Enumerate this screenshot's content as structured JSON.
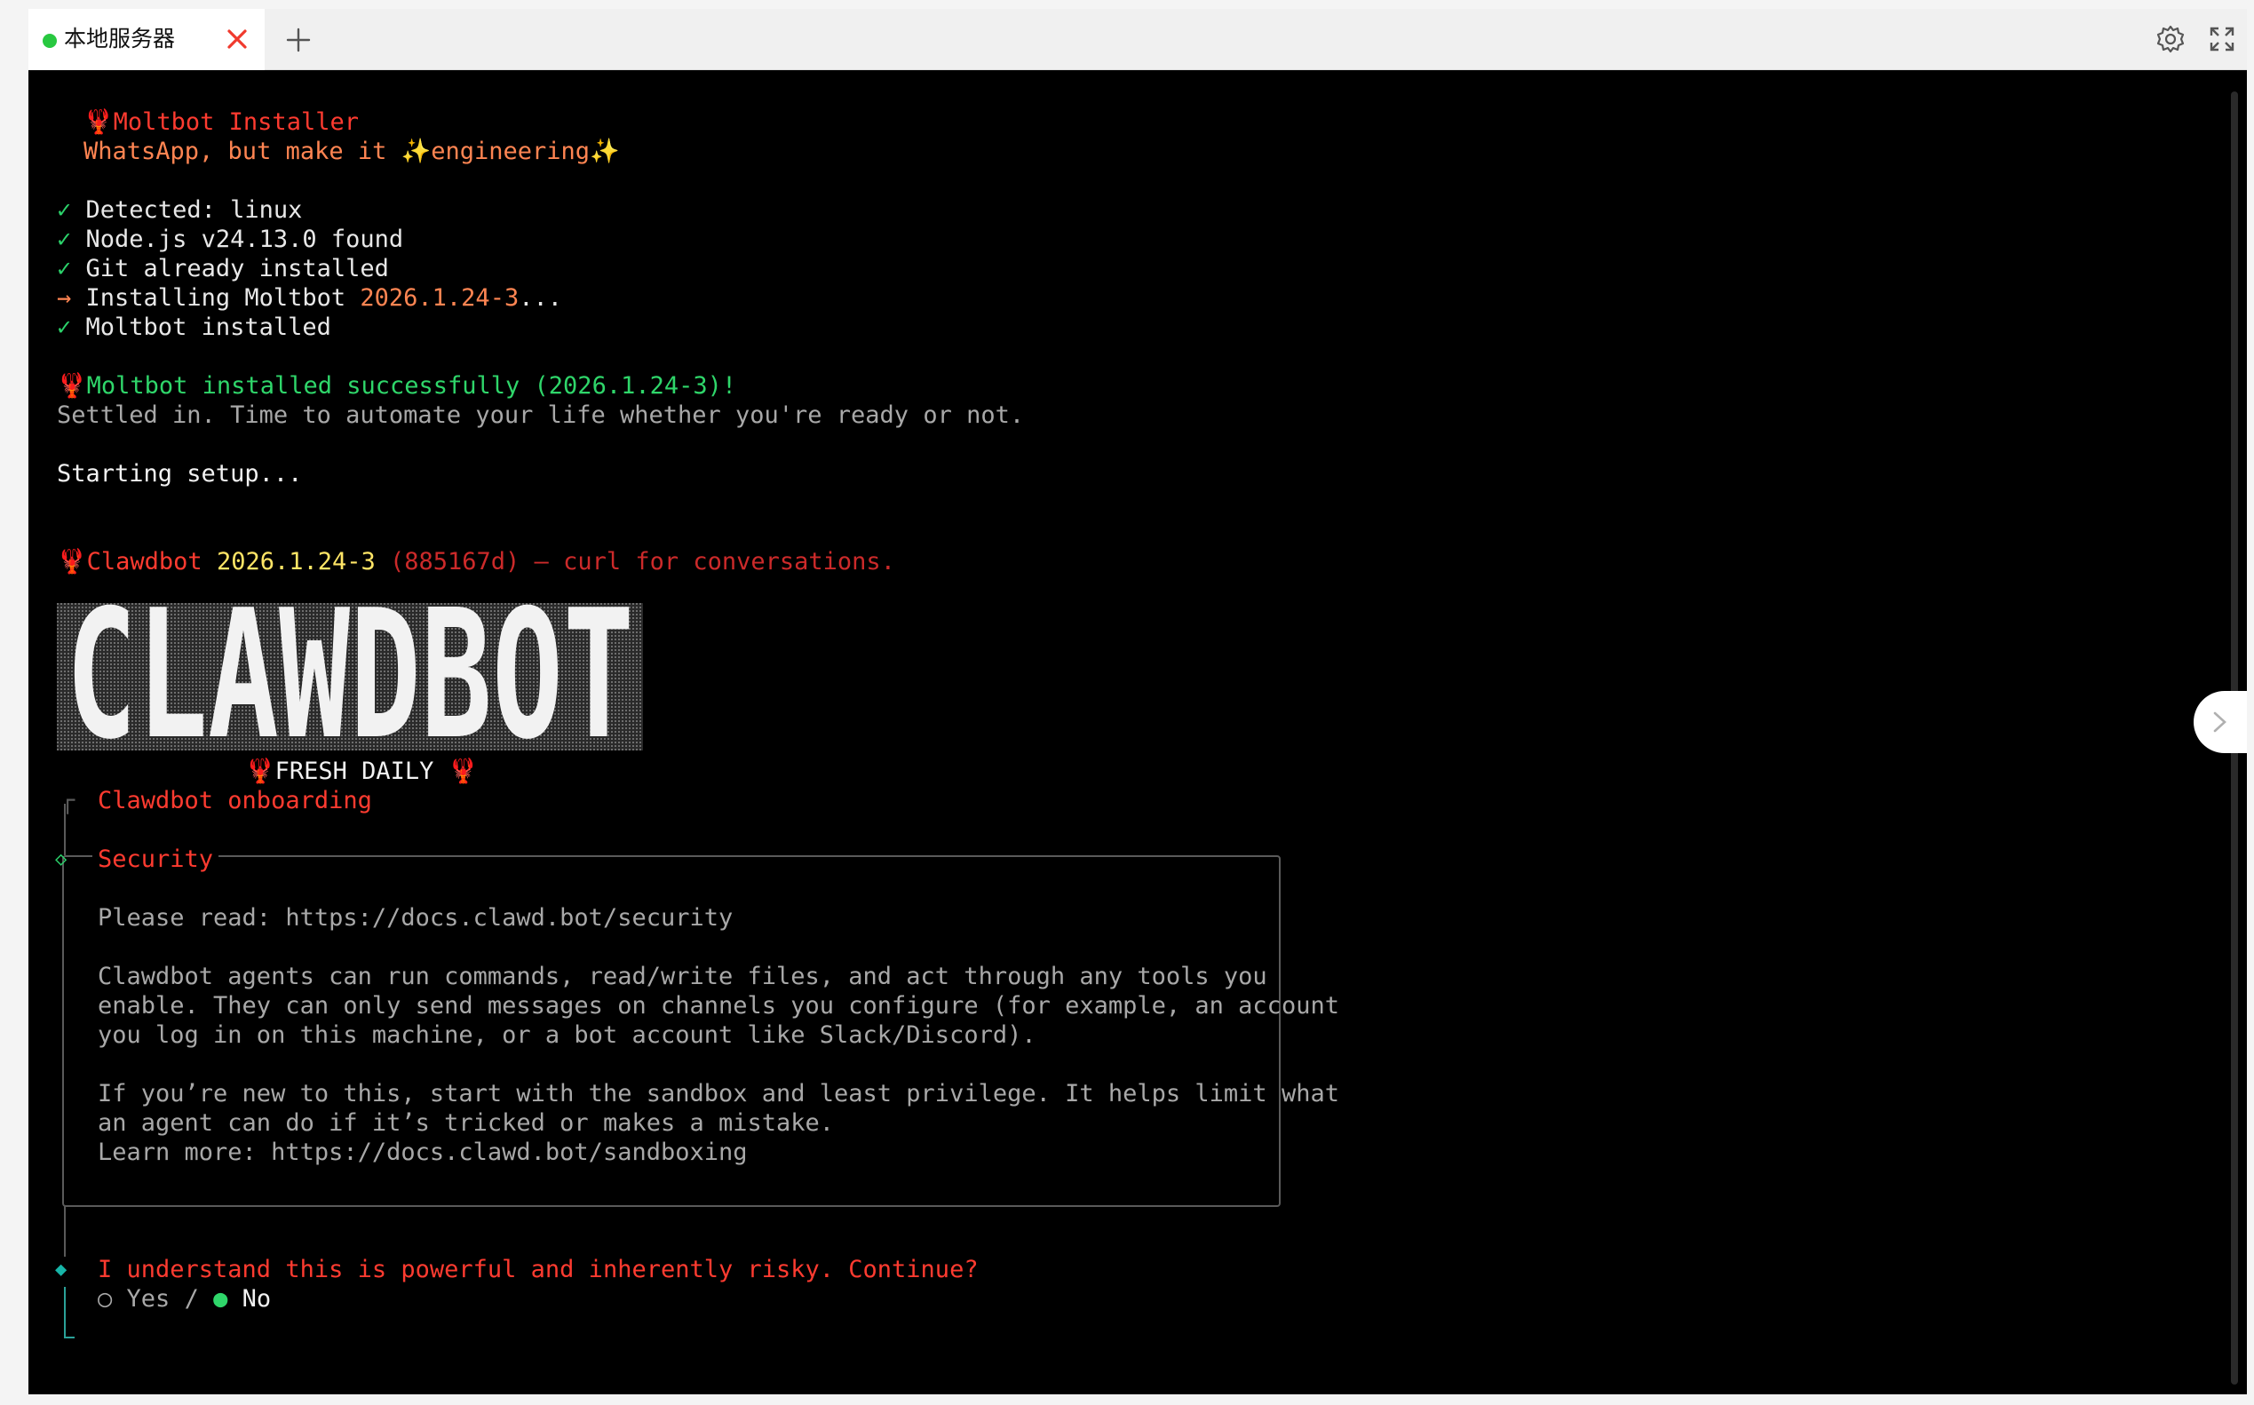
{
  "tabs": [
    {
      "label": "本地服务器",
      "status_color": "#28c840",
      "active": true
    }
  ],
  "toolbar": {
    "settings_icon": "gear-icon",
    "fullscreen_icon": "expand-icon",
    "add_icon": "plus-icon",
    "close_icon": "close-icon"
  },
  "terminal": {
    "installer_title": "Moltbot Installer",
    "installer_tagline_pre": "WhatsApp, but make it ",
    "installer_tagline_word": "engineering",
    "checks": [
      {
        "mark": "✓",
        "text": "Detected: linux"
      },
      {
        "mark": "✓",
        "text": "Node.js v24.13.0 found"
      },
      {
        "mark": "✓",
        "text": "Git already installed"
      }
    ],
    "installing_mark": "→",
    "installing_prefix": "Installing Moltbot ",
    "installing_version": "2026.1.24-3",
    "installing_suffix": "...",
    "installed_mark": "✓",
    "installed_text": "Moltbot installed",
    "success_line": "Moltbot installed successfully (2026.1.24-3)!",
    "settled_line": "Settled in. Time to automate your life whether you're ready or not.",
    "starting_line": "Starting setup...",
    "clawdbot_name": "Clawdbot ",
    "clawdbot_version": "2026.1.24-3",
    "clawdbot_tail": " (885167d) — curl for conversations.",
    "banner_text": "CLAWDBOT",
    "fresh_daily": "FRESH DAILY",
    "onboarding_title": "Clawdbot onboarding",
    "security_title": "Security",
    "security_lines": [
      "Please read: https://docs.clawd.bot/security",
      "",
      "Clawdbot agents can run commands, read/write files, and act through any tools you",
      "enable. They can only send messages on channels you configure (for example, an account",
      "you log in on this machine, or a bot account like Slack/Discord).",
      "",
      "If you’re new to this, start with the sandbox and least privilege. It helps limit what",
      "an agent can do if it’s tricked or makes a mistake.",
      "Learn more: https://docs.clawd.bot/sandboxing"
    ],
    "prompt_question": "I understand this is powerful and inherently risky. Continue?",
    "options": [
      {
        "label": "Yes",
        "selected": false
      },
      {
        "label": "No",
        "selected": true
      }
    ],
    "options_separator": " / "
  }
}
